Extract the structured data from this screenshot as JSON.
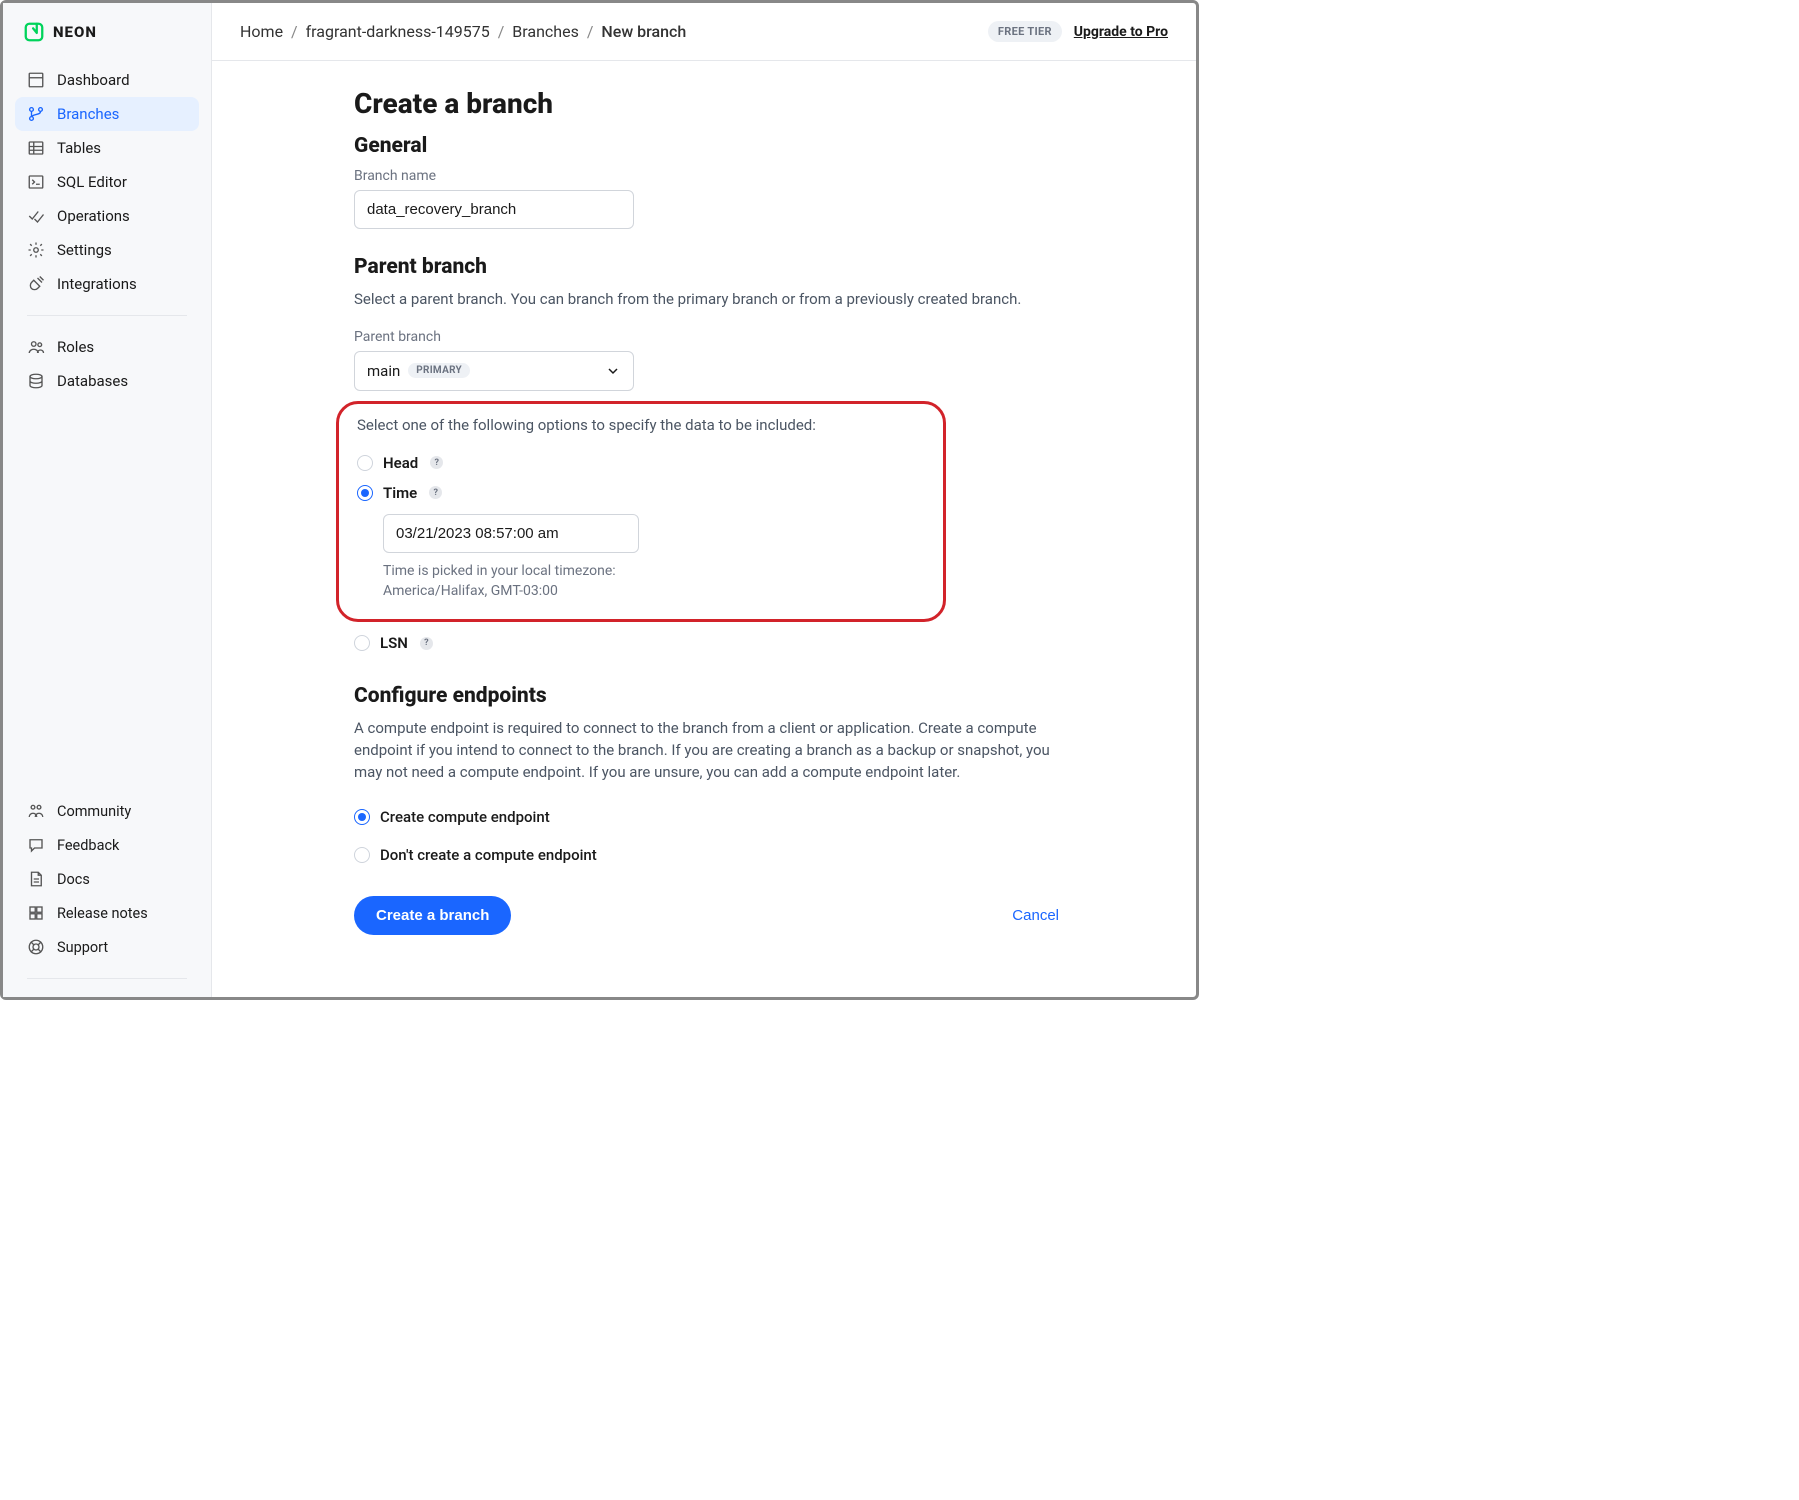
{
  "brand": {
    "name": "NEON"
  },
  "sidebar": {
    "main": [
      {
        "id": "dashboard",
        "label": "Dashboard",
        "icon": "layout"
      },
      {
        "id": "branches",
        "label": "Branches",
        "icon": "git-branch",
        "active": true
      },
      {
        "id": "tables",
        "label": "Tables",
        "icon": "table"
      },
      {
        "id": "sql-editor",
        "label": "SQL Editor",
        "icon": "terminal"
      },
      {
        "id": "operations",
        "label": "Operations",
        "icon": "check-double"
      },
      {
        "id": "settings",
        "label": "Settings",
        "icon": "gear"
      },
      {
        "id": "integrations",
        "label": "Integrations",
        "icon": "plug"
      }
    ],
    "secondary": [
      {
        "id": "roles",
        "label": "Roles",
        "icon": "users"
      },
      {
        "id": "databases",
        "label": "Databases",
        "icon": "database"
      }
    ],
    "bottom": [
      {
        "id": "community",
        "label": "Community",
        "icon": "community"
      },
      {
        "id": "feedback",
        "label": "Feedback",
        "icon": "message"
      },
      {
        "id": "docs",
        "label": "Docs",
        "icon": "file"
      },
      {
        "id": "release-notes",
        "label": "Release notes",
        "icon": "grid"
      },
      {
        "id": "support",
        "label": "Support",
        "icon": "lifebuoy"
      }
    ]
  },
  "breadcrumbs": [
    {
      "label": "Home"
    },
    {
      "label": "fragrant-darkness-149575"
    },
    {
      "label": "Branches"
    },
    {
      "label": "New branch",
      "current": true
    }
  ],
  "header": {
    "tier_badge": "FREE TIER",
    "upgrade_label": "Upgrade to Pro"
  },
  "page": {
    "title": "Create a branch",
    "general_heading": "General",
    "branch_name_label": "Branch name",
    "branch_name_value": "data_recovery_branch",
    "parent_heading": "Parent branch",
    "parent_desc": "Select a parent branch. You can branch from the primary branch or from a previously created branch.",
    "parent_label": "Parent branch",
    "parent_value": "main",
    "parent_primary_badge": "PRIMARY",
    "data_prompt": "Select one of the following options to specify the data to be included:",
    "data_options": {
      "head": {
        "label": "Head",
        "checked": false
      },
      "time": {
        "label": "Time",
        "checked": true,
        "value": "03/21/2023 08:57:00 am",
        "tz_note_line1": "Time is picked in your local timezone:",
        "tz_note_line2": "America/Halifax, GMT-03:00"
      },
      "lsn": {
        "label": "LSN",
        "checked": false
      }
    },
    "endpoints_heading": "Configure endpoints",
    "endpoints_desc": "A compute endpoint is required to connect to the branch from a client or application. Create a compute endpoint if you intend to connect to the branch. If you are creating a branch as a backup or snapshot, you may not need a compute endpoint. If you are unsure, you can add a compute endpoint later.",
    "endpoint_options": {
      "create": {
        "label": "Create compute endpoint",
        "checked": true
      },
      "none": {
        "label": "Don't create a compute endpoint",
        "checked": false
      }
    },
    "submit_label": "Create a branch",
    "cancel_label": "Cancel"
  }
}
